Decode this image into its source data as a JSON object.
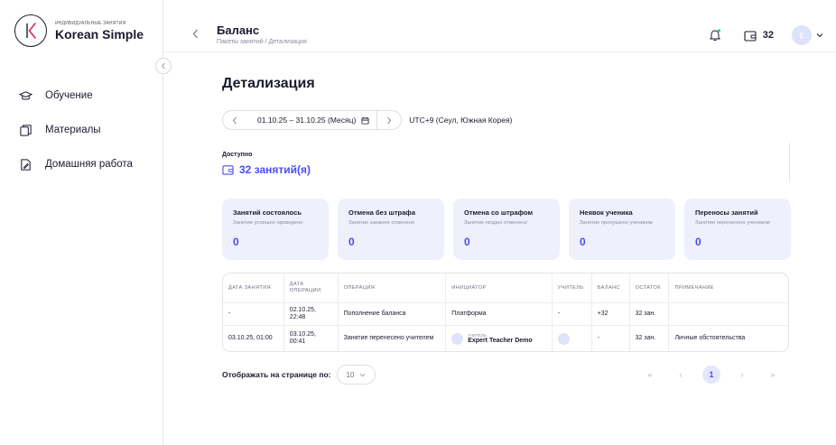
{
  "sidebar": {
    "brand_sub": "Индивидуальные занятия",
    "brand_name": "Korean Simple",
    "items": [
      {
        "label": "Обучение",
        "icon": "graduation-cap-icon"
      },
      {
        "label": "Материалы",
        "icon": "copy-icon"
      },
      {
        "label": "Домашняя работа",
        "icon": "edit-document-icon"
      }
    ]
  },
  "header": {
    "title": "Баланс",
    "breadcrumb": "Пакеты занятий / Детализация",
    "wallet_count": "32",
    "avatar_initial": "E"
  },
  "main": {
    "page_title": "Детализация",
    "date_range": "01.10.25 – 31.10.25 (Месяц)",
    "timezone": "UTC+9 (Сеул, Южная Корея)",
    "available_label": "Доступно",
    "available_value": "32 занятий(я)",
    "cards": [
      {
        "title": "Занятий состоялось",
        "sub": "Занятие успешно проведено",
        "value": "0"
      },
      {
        "title": "Отмена без штрафа",
        "sub": "Занятие заранее отменено",
        "value": "0"
      },
      {
        "title": "Отмена со штрафом",
        "sub": "Занятие поздно отменено",
        "value": "0"
      },
      {
        "title": "Неявок ученика",
        "sub": "Занятие пропущено учеником",
        "value": "0"
      },
      {
        "title": "Переносы занятий",
        "sub": "Занятие перенесено учеником",
        "value": "0"
      }
    ],
    "table": {
      "headers": [
        "Дата занятия",
        "Дата операции",
        "Операция",
        "Инициатор",
        "Учитель",
        "Баланс",
        "Остаток",
        "Примечание"
      ],
      "rows": [
        {
          "lesson_date": "-",
          "op_date": "02.10.25, 22:48",
          "operation": "Пополнение баланса",
          "initiator": "Платформа",
          "teacher": "-",
          "balance": "+32",
          "remainder": "32 зан.",
          "note": ""
        },
        {
          "lesson_date": "03.10.25, 01:00",
          "op_date": "03.10.25, 00:41",
          "operation": "Занятие перенесено учителем",
          "initiator_role": "Учитель",
          "initiator": "Expert Teacher Demo",
          "teacher": "",
          "balance": "-",
          "remainder": "32 зан.",
          "note": "Личные обстоятельства"
        }
      ]
    },
    "per_page_label": "Отображать на странице по:",
    "per_page_value": "10",
    "pagination": {
      "first": "«",
      "prev": "‹",
      "current": "1",
      "next": "›",
      "last": "»"
    }
  },
  "colors": {
    "accent": "#4b4cf0",
    "card_bg": "#eef0fb",
    "avatar_bg": "#dfe2fb"
  }
}
